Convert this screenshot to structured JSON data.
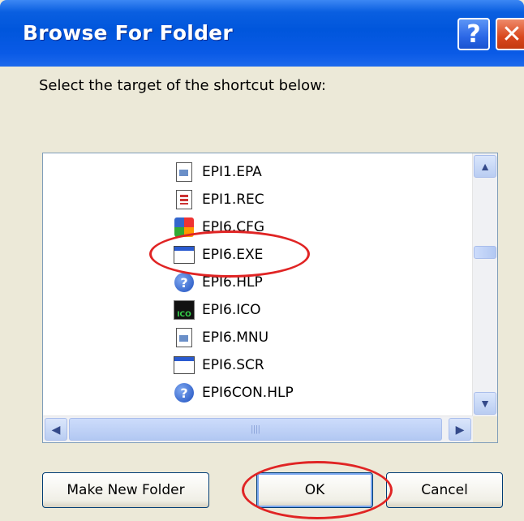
{
  "dialog": {
    "title": "Browse For Folder",
    "help_glyph": "?",
    "close_glyph": "✕",
    "prompt": "Select the target of the shortcut below:"
  },
  "tree": {
    "items": [
      {
        "label": "EPI1.EPA",
        "icon": "document-icon"
      },
      {
        "label": "EPI1.REC",
        "icon": "record-file-icon"
      },
      {
        "label": "EPI6.CFG",
        "icon": "config-file-icon"
      },
      {
        "label": "EPI6.EXE",
        "icon": "application-window-icon"
      },
      {
        "label": "EPI6.HLP",
        "icon": "help-file-icon"
      },
      {
        "label": "EPI6.ICO",
        "icon": "ico-file-icon"
      },
      {
        "label": "EPI6.MNU",
        "icon": "document-icon"
      },
      {
        "label": "EPI6.SCR",
        "icon": "application-window-icon"
      },
      {
        "label": "EPI6CON.HLP",
        "icon": "help-file-icon"
      }
    ]
  },
  "scroll": {
    "up": "▲",
    "down": "▼",
    "left": "◀",
    "right": "▶",
    "grip": "||||"
  },
  "buttons": {
    "make_new_folder": "Make New Folder",
    "ok": "OK",
    "cancel": "Cancel"
  },
  "colors": {
    "titlebar": "#0056dc",
    "dialog_bg": "#ece9d8",
    "highlight": "#e02424"
  }
}
